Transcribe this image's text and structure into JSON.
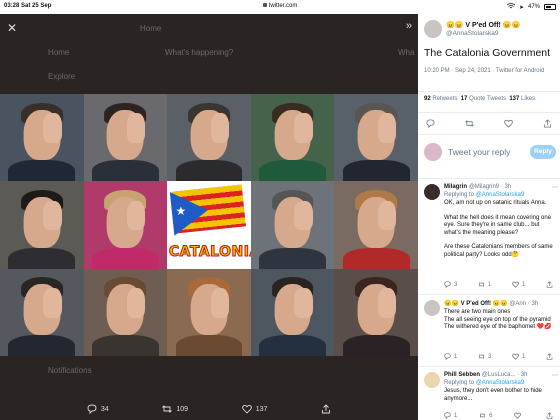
{
  "status_bar": {
    "time": "03:28",
    "date": "Sat 25 Sep",
    "url": "twitter.com",
    "battery": "47%"
  },
  "background_ui": {
    "home": "Home",
    "explore": "Explore",
    "notifications": "Notifications",
    "compose_placeholder": "What's happening?",
    "whats_label": "Wha"
  },
  "media": {
    "flag_word": "CATALONIA",
    "reply_count": "34",
    "retweet_count": "109",
    "like_count": "137"
  },
  "tweet": {
    "author_name": "😠😠 V P'ed Off! 😠😠",
    "author_handle": "@AnnaStolarska9",
    "text": "The Catalonia Government",
    "timestamp": "10:20 PM · Sep 24, 2021 · Twitter for Android",
    "retweets_count": "92",
    "retweets_label": "Retweets",
    "quotes_count": "17",
    "quotes_label": "Quote Tweets",
    "likes_count": "137",
    "likes_label": "Likes"
  },
  "composer": {
    "placeholder": "Tweet your reply",
    "button": "Reply"
  },
  "replies": [
    {
      "name": "Milagrin",
      "handle": "@Milagrin9",
      "time": "· 3h",
      "replying_prefix": "Replying to",
      "replying_to": "@AnnaStolarska9",
      "paragraphs": [
        "OK, am not up on satanic rituals Anna.",
        "What the hell does it mean covering one eye.  Sure they're in same club... but what's the meaning please?",
        "Are these Catalonians members of same political party?  Looks odd🤔"
      ],
      "reply_count": "3",
      "retweet_count": "1",
      "like_count": "1"
    },
    {
      "name": "😠😠 V P'ed Off! 😠😠",
      "handle": "@Ann",
      "time": "· 3h",
      "paragraphs": [
        "There are two main ones",
        "The all seeing eye on top of the pyramid",
        "The withered eye of the baphomet ❤️💋"
      ],
      "reply_count": "1",
      "retweet_count": "3",
      "like_count": "1"
    },
    {
      "name": "Phill Sebben",
      "handle": "@LusLuca...",
      "time": "· 3h",
      "replying_prefix": "Replying to",
      "replying_to": "@AnnaStolarska9",
      "paragraphs": [
        "Jesus, they don't even bother to hide anymore..."
      ],
      "reply_count": "1",
      "retweet_count": "6",
      "like_count": ""
    }
  ],
  "colors": {
    "accent": "#1da1f2",
    "reply_button": "#9dd0f4",
    "media_bg": "#2a2523",
    "muted": "#657786"
  }
}
